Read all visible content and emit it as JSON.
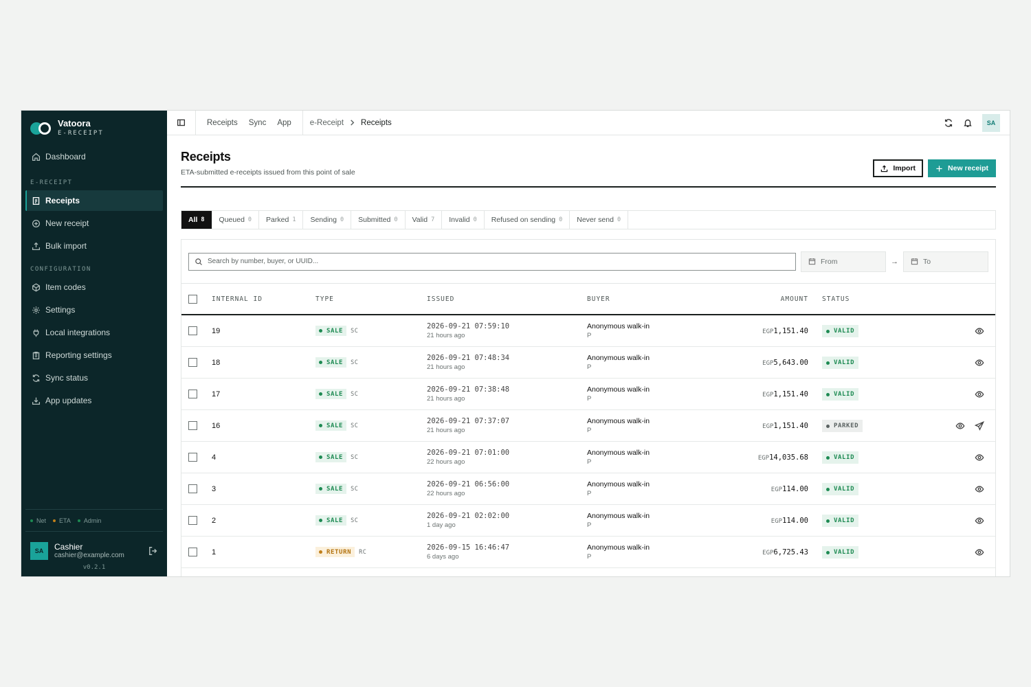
{
  "brand": {
    "name": "Vatoora",
    "subtitle": "E-RECEIPT"
  },
  "sidebar": {
    "dashboard": "Dashboard",
    "section_ereceipt": "E-RECEIPT",
    "receipts": "Receipts",
    "new_receipt": "New receipt",
    "bulk_import": "Bulk import",
    "section_config": "CONFIGURATION",
    "item_codes": "Item codes",
    "settings": "Settings",
    "local_integrations": "Local integrations",
    "reporting_settings": "Reporting settings",
    "sync_status": "Sync status",
    "app_updates": "App updates"
  },
  "status_indicators": [
    {
      "label": "Net",
      "color": "#1d8a52"
    },
    {
      "label": "ETA",
      "color": "#c07f1a"
    },
    {
      "label": "Admin",
      "color": "#1d8a52"
    }
  ],
  "user": {
    "initials": "SA",
    "name": "Cashier",
    "email": "cashier@example.com"
  },
  "version": "v0.2.1",
  "topbar": {
    "menu": [
      "Receipts",
      "Sync",
      "App"
    ],
    "breadcrumb": [
      "e-Receipt",
      "Receipts"
    ],
    "avatar": "SA"
  },
  "page": {
    "title": "Receipts",
    "subtitle": "ETA-submitted e-receipts issued from this point of sale",
    "import_label": "Import",
    "new_label": "New receipt"
  },
  "tabs": [
    {
      "label": "All",
      "count": "8",
      "active": true
    },
    {
      "label": "Queued",
      "count": "0"
    },
    {
      "label": "Parked",
      "count": "1"
    },
    {
      "label": "Sending",
      "count": "0"
    },
    {
      "label": "Submitted",
      "count": "0"
    },
    {
      "label": "Valid",
      "count": "7"
    },
    {
      "label": "Invalid",
      "count": "0"
    },
    {
      "label": "Refused on sending",
      "count": "0"
    },
    {
      "label": "Never send",
      "count": "0"
    }
  ],
  "filters": {
    "search_placeholder": "Search by number, buyer, or UUID...",
    "from": "From",
    "arrow": "→",
    "to": "To"
  },
  "table": {
    "headers": {
      "id": "INTERNAL ID",
      "type": "TYPE",
      "issued": "ISSUED",
      "buyer": "BUYER",
      "amount": "AMOUNT",
      "status": "STATUS"
    },
    "rows": [
      {
        "id": "19",
        "type": "SALE",
        "type_code": "SC",
        "issued": "2026-09-21 07:59:10",
        "relative": "21 hours ago",
        "buyer": "Anonymous walk-in",
        "buyer_sub": "P",
        "currency": "EGP",
        "amount": "1,151.40",
        "status": "VALID"
      },
      {
        "id": "18",
        "type": "SALE",
        "type_code": "SC",
        "issued": "2026-09-21 07:48:34",
        "relative": "21 hours ago",
        "buyer": "Anonymous walk-in",
        "buyer_sub": "P",
        "currency": "EGP",
        "amount": "5,643.00",
        "status": "VALID"
      },
      {
        "id": "17",
        "type": "SALE",
        "type_code": "SC",
        "issued": "2026-09-21 07:38:48",
        "relative": "21 hours ago",
        "buyer": "Anonymous walk-in",
        "buyer_sub": "P",
        "currency": "EGP",
        "amount": "1,151.40",
        "status": "VALID"
      },
      {
        "id": "16",
        "type": "SALE",
        "type_code": "SC",
        "issued": "2026-09-21 07:37:07",
        "relative": "21 hours ago",
        "buyer": "Anonymous walk-in",
        "buyer_sub": "P",
        "currency": "EGP",
        "amount": "1,151.40",
        "status": "PARKED"
      },
      {
        "id": "4",
        "type": "SALE",
        "type_code": "SC",
        "issued": "2026-09-21 07:01:00",
        "relative": "22 hours ago",
        "buyer": "Anonymous walk-in",
        "buyer_sub": "P",
        "currency": "EGP",
        "amount": "14,035.68",
        "status": "VALID"
      },
      {
        "id": "3",
        "type": "SALE",
        "type_code": "SC",
        "issued": "2026-09-21 06:56:00",
        "relative": "22 hours ago",
        "buyer": "Anonymous walk-in",
        "buyer_sub": "P",
        "currency": "EGP",
        "amount": "114.00",
        "status": "VALID"
      },
      {
        "id": "2",
        "type": "SALE",
        "type_code": "SC",
        "issued": "2026-09-21 02:02:00",
        "relative": "1 day ago",
        "buyer": "Anonymous walk-in",
        "buyer_sub": "P",
        "currency": "EGP",
        "amount": "114.00",
        "status": "VALID"
      },
      {
        "id": "1",
        "type": "RETURN",
        "type_code": "RC",
        "issued": "2026-09-15 16:46:47",
        "relative": "6 days ago",
        "buyer": "Anonymous walk-in",
        "buyer_sub": "P",
        "currency": "EGP",
        "amount": "6,725.43",
        "status": "VALID"
      }
    ]
  }
}
